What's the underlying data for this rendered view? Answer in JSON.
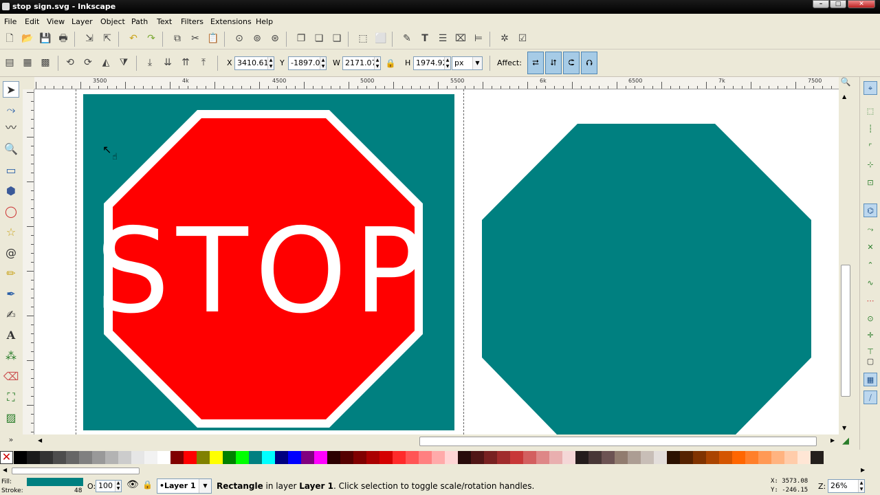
{
  "window": {
    "title": "stop sign.svg - Inkscape"
  },
  "menu": [
    "File",
    "Edit",
    "View",
    "Layer",
    "Object",
    "Path",
    "Text",
    "Filters",
    "Extensions",
    "Help"
  ],
  "toolbar": {
    "x_label": "X",
    "x_value": "3410.61",
    "y_label": "Y",
    "y_value": "-1897.0",
    "w_label": "W",
    "w_value": "2171.07",
    "h_label": "H",
    "h_value": "1974.92",
    "unit": "px",
    "affect_label": "Affect:"
  },
  "ruler": {
    "labels": [
      "3500",
      "4k",
      "4500",
      "5000",
      "5500",
      "6k",
      "6500",
      "7k",
      "7500"
    ]
  },
  "canvas": {
    "stop_text": "STOP",
    "colors": {
      "teal": "#008080",
      "red": "#ff0000",
      "white": "#ffffff"
    }
  },
  "status": {
    "fill_label": "Fill:",
    "stroke_label": "Stroke:",
    "stroke_width": "48",
    "opacity_label": "O:",
    "opacity_value": "100",
    "layer": "•Layer 1",
    "message_obj": "Rectangle",
    "message_mid": " in layer ",
    "message_layer": "Layer 1",
    "message_end": ". Click selection to toggle scale/rotation handles.",
    "cursor_x": "X: 3573.08",
    "cursor_y": "Y: -246.15",
    "zoom_label": "Z:",
    "zoom_value": "26%"
  },
  "palette": [
    "#000000",
    "#1a1a1a",
    "#333333",
    "#4d4d4d",
    "#666666",
    "#808080",
    "#999999",
    "#b3b3b3",
    "#cccccc",
    "#e6e6e6",
    "#f2f2f2",
    "#ffffff",
    "#800000",
    "#ff0000",
    "#808000",
    "#ffff00",
    "#008000",
    "#00ff00",
    "#008080",
    "#00ffff",
    "#000080",
    "#0000ff",
    "#800080",
    "#ff00ff",
    "#2b0000",
    "#550000",
    "#800000",
    "#aa0000",
    "#d40000",
    "#ff2a2a",
    "#ff5555",
    "#ff8080",
    "#ffaaaa",
    "#ffd5d5",
    "#280b0b",
    "#501616",
    "#782121",
    "#a02c2c",
    "#c83737",
    "#d35f5f",
    "#de8787",
    "#e9afaf",
    "#f4d7d7",
    "#241c1c",
    "#483737",
    "#6c5353",
    "#917c6f",
    "#ac9d93",
    "#c8beb7",
    "#e3dedb",
    "#2b1100",
    "#552200",
    "#803300",
    "#aa4400",
    "#d45500",
    "#ff6600",
    "#ff7f2a",
    "#ff9955",
    "#ffb380",
    "#ffccaa",
    "#ffe6d5",
    "#241f1c"
  ]
}
